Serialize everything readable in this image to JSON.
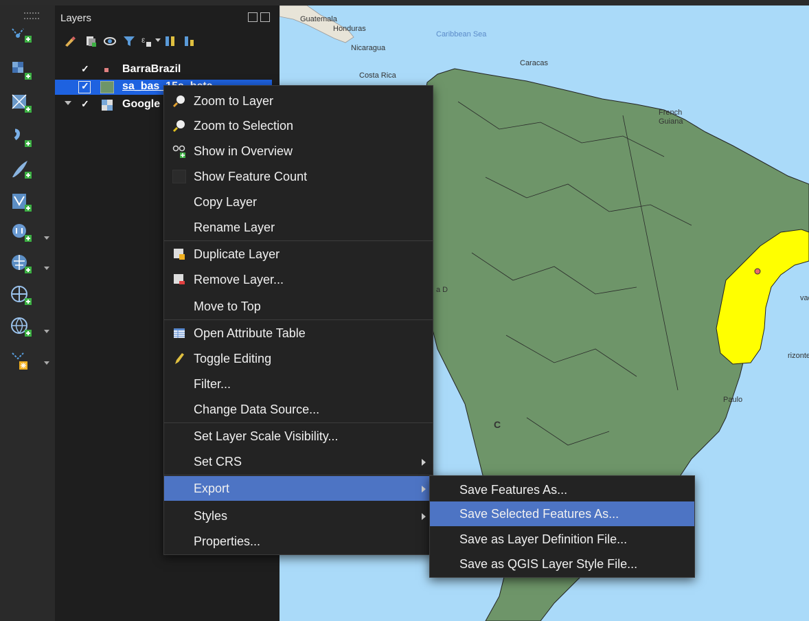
{
  "layers_panel": {
    "title": "Layers",
    "layers": [
      {
        "name": "BarraBrazil",
        "checked": true,
        "selected": false,
        "expandable": false
      },
      {
        "name": "sa_bas_15a_beta",
        "checked": true,
        "selected": true,
        "expandable": false
      },
      {
        "name": "Google",
        "checked": true,
        "selected": false,
        "expandable": true
      }
    ]
  },
  "map": {
    "labels": {
      "guatemala": "Guatemala",
      "honduras": "Honduras",
      "nicaragua": "Nicaragua",
      "costa_rica": "Costa Rica",
      "caribbean": "Caribbean Sea",
      "caracas": "Caracas",
      "french": "French",
      "guiana": "Guiana",
      "paulo": "Paulo",
      "horizonte": "rizonte",
      "vad": "vad",
      "mad": "a D",
      "c": "C"
    },
    "colors": {
      "sea": "#aadaf9",
      "land": "#6e9569",
      "selection": "#ffff00"
    }
  },
  "context_menu": {
    "items": [
      {
        "label": "Zoom to Layer",
        "icon": "zoom-layer-icon"
      },
      {
        "label": "Zoom to Selection",
        "icon": "zoom-selection-icon"
      },
      {
        "label": "Show in Overview",
        "icon": "overview-icon"
      },
      {
        "label": "Show Feature Count",
        "icon": "checkbox-icon"
      },
      {
        "label": "Copy Layer",
        "icon": ""
      },
      {
        "label": "Rename Layer",
        "icon": ""
      },
      {
        "label": "Duplicate Layer",
        "icon": "duplicate-icon"
      },
      {
        "label": "Remove Layer...",
        "icon": "remove-icon"
      },
      {
        "label": "Move to Top",
        "icon": ""
      },
      {
        "label": "Open Attribute Table",
        "icon": "table-icon"
      },
      {
        "label": "Toggle Editing",
        "icon": "pencil-icon"
      },
      {
        "label": "Filter...",
        "icon": ""
      },
      {
        "label": "Change Data Source...",
        "icon": ""
      },
      {
        "label": "Set Layer Scale Visibility...",
        "icon": ""
      },
      {
        "label": "Set CRS",
        "icon": "",
        "submenu": true
      },
      {
        "label": "Export",
        "icon": "",
        "submenu": true,
        "highlighted": true
      },
      {
        "label": "Styles",
        "icon": "",
        "submenu": true
      },
      {
        "label": "Properties...",
        "icon": ""
      }
    ]
  },
  "export_submenu": {
    "items": [
      {
        "label": "Save Features As..."
      },
      {
        "label": "Save Selected Features As...",
        "highlighted": true
      },
      {
        "label": "Save as Layer Definition File..."
      },
      {
        "label": "Save as QGIS Layer Style File..."
      }
    ]
  }
}
